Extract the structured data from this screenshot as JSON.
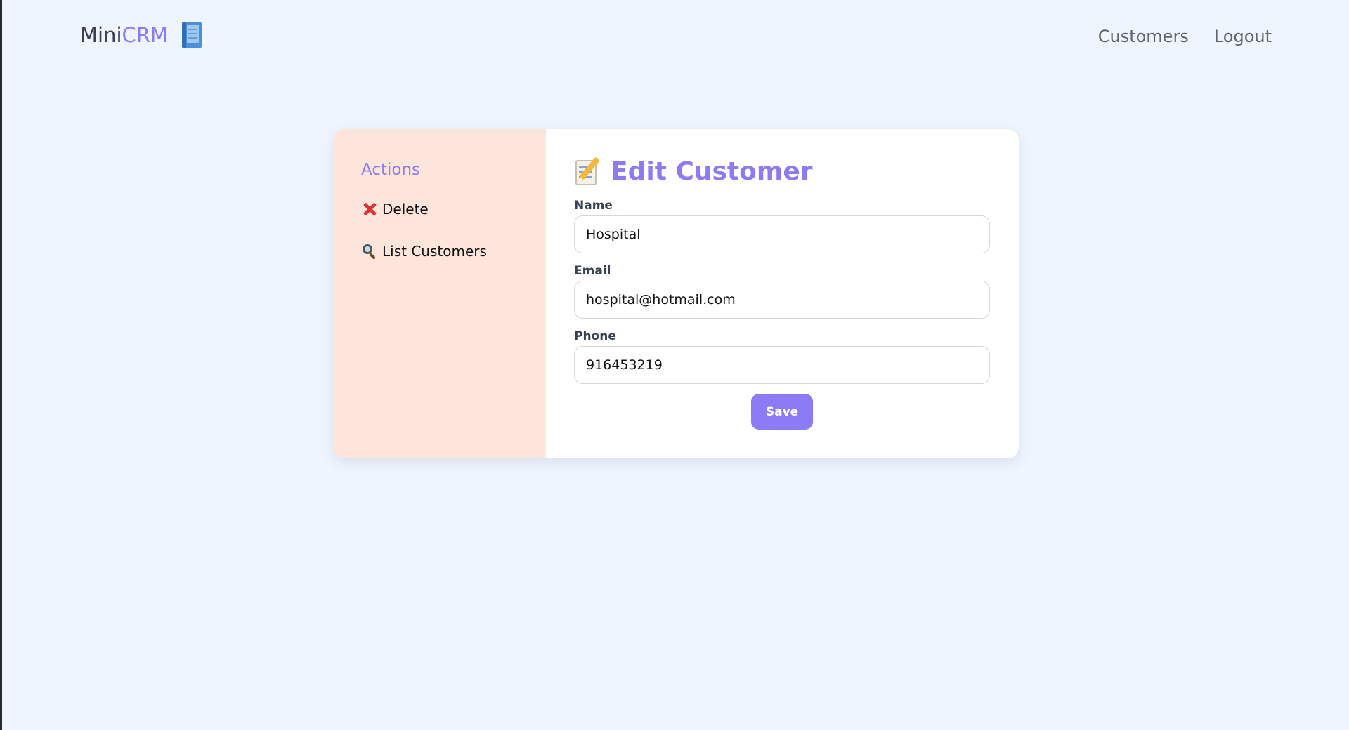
{
  "app": {
    "brand_part1": "Mini",
    "brand_part2": "CRM",
    "brand_icon": "blue-notebook-icon",
    "accent_color": "#8b7cf6"
  },
  "nav": {
    "items": [
      {
        "label": "Customers"
      },
      {
        "label": "Logout"
      }
    ]
  },
  "sidebar": {
    "title": "Actions",
    "items": [
      {
        "label": "Delete",
        "icon": "cross-mark-icon"
      },
      {
        "label": "List Customers",
        "icon": "magnifier-icon"
      }
    ]
  },
  "form": {
    "title": "Edit Customer",
    "title_icon": "memo-icon",
    "fields": [
      {
        "label": "Name",
        "value": "Hospital"
      },
      {
        "label": "Email",
        "value": "hospital@hotmail.com"
      },
      {
        "label": "Phone",
        "value": "916453219"
      }
    ],
    "save_label": "Save"
  }
}
